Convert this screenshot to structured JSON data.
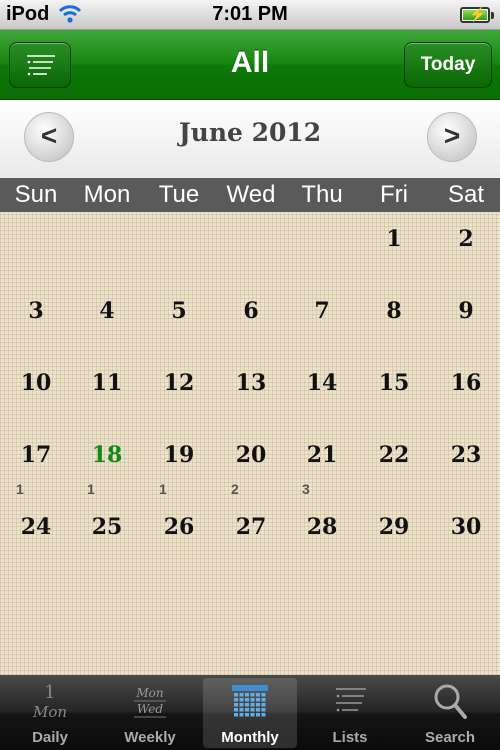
{
  "status_bar": {
    "carrier": "iPod",
    "time": "7:01 PM"
  },
  "nav": {
    "title": "All",
    "today_label": "Today"
  },
  "month": {
    "title": "June 2012"
  },
  "weekdays": [
    "Sun",
    "Mon",
    "Tue",
    "Wed",
    "Thu",
    "Fri",
    "Sat"
  ],
  "calendar": {
    "today": "18",
    "weeks": [
      [
        {
          "day": ""
        },
        {
          "day": ""
        },
        {
          "day": ""
        },
        {
          "day": ""
        },
        {
          "day": ""
        },
        {
          "day": "1"
        },
        {
          "day": "2"
        }
      ],
      [
        {
          "day": "3"
        },
        {
          "day": "4"
        },
        {
          "day": "5"
        },
        {
          "day": "6"
        },
        {
          "day": "7"
        },
        {
          "day": "8"
        },
        {
          "day": "9"
        }
      ],
      [
        {
          "day": "10"
        },
        {
          "day": "11"
        },
        {
          "day": "12"
        },
        {
          "day": "13"
        },
        {
          "day": "14"
        },
        {
          "day": "15"
        },
        {
          "day": "16"
        }
      ],
      [
        {
          "day": "17",
          "events": "1"
        },
        {
          "day": "18",
          "events": "1"
        },
        {
          "day": "19",
          "events": "1"
        },
        {
          "day": "20",
          "events": "2"
        },
        {
          "day": "21",
          "events": "3"
        },
        {
          "day": "22"
        },
        {
          "day": "23"
        }
      ],
      [
        {
          "day": "24"
        },
        {
          "day": "25"
        },
        {
          "day": "26"
        },
        {
          "day": "27"
        },
        {
          "day": "28"
        },
        {
          "day": "29"
        },
        {
          "day": "30"
        }
      ]
    ]
  },
  "tabs": [
    {
      "label": "Daily",
      "icon": "daily-calendar-icon",
      "icon_text": [
        "1",
        "Mon"
      ]
    },
    {
      "label": "Weekly",
      "icon": "weekly-calendar-icon",
      "icon_text": [
        "Mon",
        "Wed"
      ]
    },
    {
      "label": "Monthly",
      "icon": "monthly-grid-icon",
      "selected": true
    },
    {
      "label": "Lists",
      "icon": "list-icon"
    },
    {
      "label": "Search",
      "icon": "search-icon"
    }
  ],
  "colors": {
    "nav_green": "#17870f",
    "today_green": "#138a12",
    "weekday_bar": "#5a5a5a"
  }
}
